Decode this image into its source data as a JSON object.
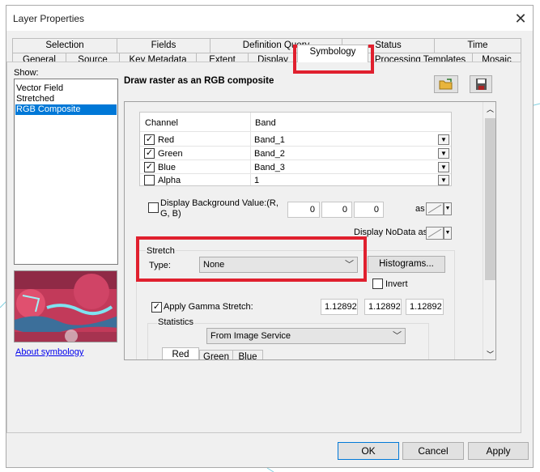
{
  "window": {
    "title": "Layer Properties",
    "close_glyph": "✕"
  },
  "tabs_row1": [
    "Selection",
    "Fields",
    "Definition Query",
    "Status",
    "Time"
  ],
  "tabs_row2": [
    "General",
    "Source",
    "Key Metadata",
    "Extent",
    "Display",
    "Symbology",
    "Processing Templates",
    "Mosaic"
  ],
  "active_tab": "Symbology",
  "show": {
    "label": "Show:",
    "items": [
      "Vector Field",
      "Stretched",
      "RGB Composite"
    ],
    "selected": "RGB Composite",
    "about_link": "About symbology"
  },
  "heading": "Draw raster as an RGB composite",
  "toolbar_icons": [
    "open-folder-icon",
    "save-icon"
  ],
  "channels": {
    "headers": [
      "Channel",
      "Band"
    ],
    "rows": [
      {
        "name": "Red",
        "band": "Band_1",
        "checked": true
      },
      {
        "name": "Green",
        "band": "Band_2",
        "checked": true
      },
      {
        "name": "Blue",
        "band": "Band_3",
        "checked": true
      },
      {
        "name": "Alpha",
        "band": "1",
        "checked": false
      }
    ]
  },
  "background": {
    "label_line1": "Display Background Value:(R,",
    "label_line2": "G, B)",
    "values": [
      "0",
      "0",
      "0"
    ],
    "as_label": "as",
    "nodata_label": "Display NoData as"
  },
  "stretch": {
    "group_label": "Stretch",
    "type_label": "Type:",
    "type_value": "None",
    "histograms_button": "Histograms...",
    "invert_label": "Invert"
  },
  "gamma": {
    "label": "Apply Gamma Stretch:",
    "values": [
      "1.12892",
      "1.12892",
      "1.12892"
    ]
  },
  "statistics": {
    "label": "Statistics",
    "source": "From Image Service",
    "tabs": [
      "Red",
      "Green",
      "Blue"
    ]
  },
  "buttons": {
    "ok": "OK",
    "cancel": "Cancel",
    "apply": "Apply"
  },
  "colors": {
    "highlight": "#e0202e",
    "selection": "#0078d7"
  }
}
